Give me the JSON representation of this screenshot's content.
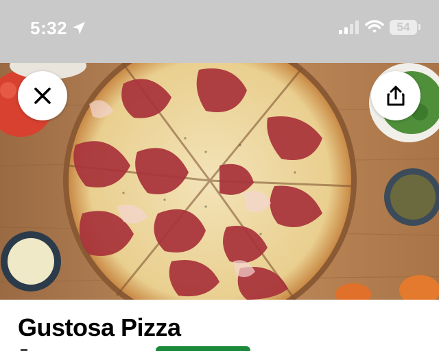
{
  "status_bar": {
    "time": "5:32",
    "battery": "54",
    "icons": [
      "location-arrow-icon",
      "cellular-signal-icon",
      "wifi-icon",
      "battery-icon"
    ]
  },
  "hero": {
    "image_subject": "pizza-hero-image",
    "close_icon": "close-icon",
    "share_icon": "share-icon"
  },
  "store": {
    "name": "Gustosa Pizza"
  },
  "colors": {
    "status_bar_bg": "#c9c9c9",
    "accent_green": "#1b8a3b"
  }
}
